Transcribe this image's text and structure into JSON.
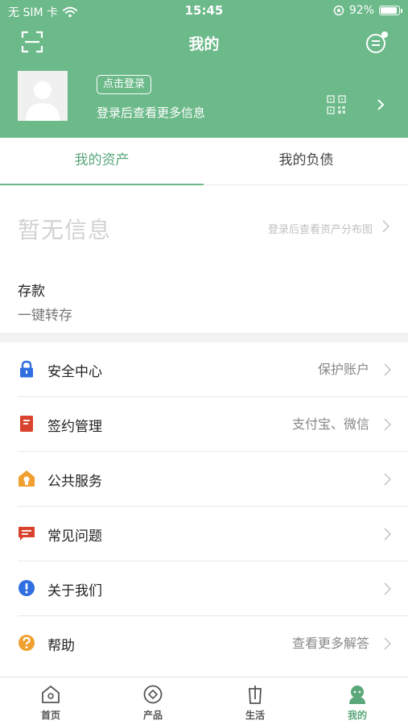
{
  "status_bar": {
    "carrier": "无 SIM 卡",
    "time": "15:45",
    "battery": "92%",
    "battery_level": 0.92
  },
  "nav": {
    "title": "我的",
    "left_icon": "scan-icon",
    "right_icon": "message-icon"
  },
  "profile": {
    "login_button": "点击登录",
    "hint": "登录后查看更多信息",
    "qr_icon": "qr-code-icon"
  },
  "tabs": [
    {
      "label": "我的资产",
      "active": true
    },
    {
      "label": "我的负债",
      "active": false
    }
  ],
  "assets": {
    "empty_text": "暂无信息",
    "distribution_hint": "登录后查看资产分布图"
  },
  "deposit": {
    "label": "存款",
    "sub": "一键转存"
  },
  "menu": [
    {
      "label": "安全中心",
      "value": "保护账户",
      "icon": "lock-icon",
      "color": "#2f6fe0"
    },
    {
      "label": "签约管理",
      "value": "支付宝、微信",
      "icon": "contract-icon",
      "color": "#d9432e"
    },
    {
      "label": "公共服务",
      "value": "",
      "icon": "public-service-icon",
      "color": "#f0a030"
    },
    {
      "label": "常见问题",
      "value": "",
      "icon": "faq-icon",
      "color": "#d9432e"
    },
    {
      "label": "关于我们",
      "value": "",
      "icon": "info-icon",
      "color": "#2f6fe0"
    },
    {
      "label": "帮助",
      "value": "查看更多解答",
      "icon": "help-icon",
      "color": "#f0a030"
    }
  ],
  "tabbar": [
    {
      "label": "首页",
      "icon": "home-icon",
      "active": false
    },
    {
      "label": "产品",
      "icon": "product-icon",
      "active": false
    },
    {
      "label": "生活",
      "icon": "life-icon",
      "active": false
    },
    {
      "label": "我的",
      "icon": "profile-icon",
      "active": true
    }
  ],
  "colors": {
    "brand_green": "#6cb98a",
    "active_green": "#5aa77a"
  }
}
